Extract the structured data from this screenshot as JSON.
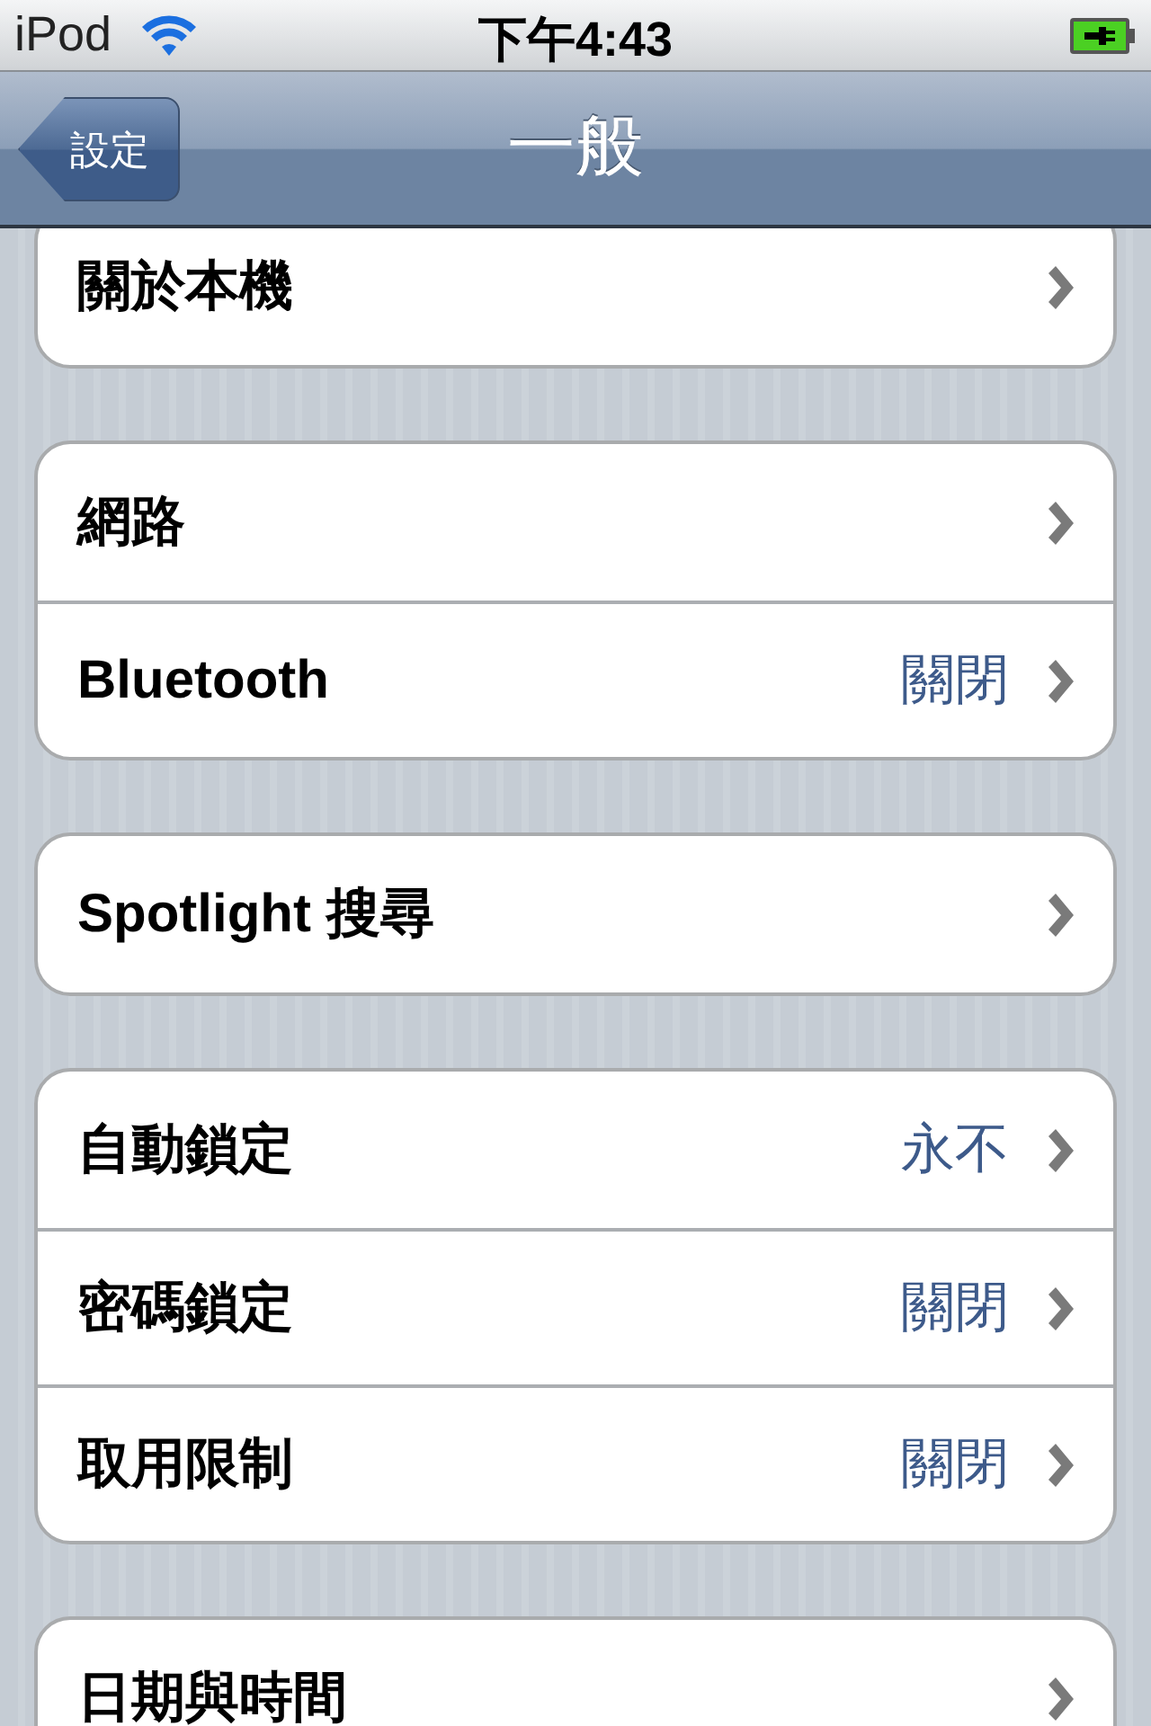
{
  "status_bar": {
    "carrier": "iPod",
    "time": "下午4:43"
  },
  "nav_bar": {
    "back": "設定",
    "title": "一般"
  },
  "groups": [
    {
      "rows": [
        {
          "label": "關於本機"
        }
      ]
    },
    {
      "rows": [
        {
          "label": "網路"
        },
        {
          "label": "Bluetooth",
          "value": "關閉"
        }
      ]
    },
    {
      "rows": [
        {
          "label": "Spotlight 搜尋"
        }
      ]
    },
    {
      "rows": [
        {
          "label": "自動鎖定",
          "value": "永不"
        },
        {
          "label": "密碼鎖定",
          "value": "關閉"
        },
        {
          "label": "取用限制",
          "value": "關閉"
        }
      ]
    },
    {
      "rows": [
        {
          "label": "日期與時間"
        }
      ]
    }
  ]
}
